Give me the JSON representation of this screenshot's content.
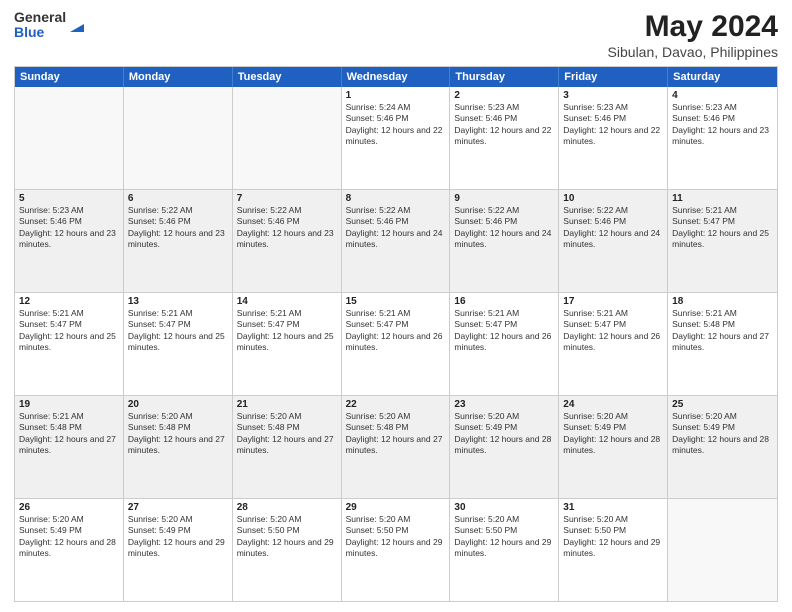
{
  "logo": {
    "line1": "General",
    "line2": "Blue"
  },
  "header": {
    "month_year": "May 2024",
    "location": "Sibulan, Davao, Philippines"
  },
  "days": [
    "Sunday",
    "Monday",
    "Tuesday",
    "Wednesday",
    "Thursday",
    "Friday",
    "Saturday"
  ],
  "weeks": [
    [
      {
        "day": "",
        "info": "",
        "empty": true
      },
      {
        "day": "",
        "info": "",
        "empty": true
      },
      {
        "day": "",
        "info": "",
        "empty": true
      },
      {
        "day": "1",
        "info": "Sunrise: 5:24 AM\nSunset: 5:46 PM\nDaylight: 12 hours and 22 minutes."
      },
      {
        "day": "2",
        "info": "Sunrise: 5:23 AM\nSunset: 5:46 PM\nDaylight: 12 hours and 22 minutes."
      },
      {
        "day": "3",
        "info": "Sunrise: 5:23 AM\nSunset: 5:46 PM\nDaylight: 12 hours and 22 minutes."
      },
      {
        "day": "4",
        "info": "Sunrise: 5:23 AM\nSunset: 5:46 PM\nDaylight: 12 hours and 23 minutes."
      }
    ],
    [
      {
        "day": "5",
        "info": "Sunrise: 5:23 AM\nSunset: 5:46 PM\nDaylight: 12 hours and 23 minutes."
      },
      {
        "day": "6",
        "info": "Sunrise: 5:22 AM\nSunset: 5:46 PM\nDaylight: 12 hours and 23 minutes."
      },
      {
        "day": "7",
        "info": "Sunrise: 5:22 AM\nSunset: 5:46 PM\nDaylight: 12 hours and 23 minutes."
      },
      {
        "day": "8",
        "info": "Sunrise: 5:22 AM\nSunset: 5:46 PM\nDaylight: 12 hours and 24 minutes."
      },
      {
        "day": "9",
        "info": "Sunrise: 5:22 AM\nSunset: 5:46 PM\nDaylight: 12 hours and 24 minutes."
      },
      {
        "day": "10",
        "info": "Sunrise: 5:22 AM\nSunset: 5:46 PM\nDaylight: 12 hours and 24 minutes."
      },
      {
        "day": "11",
        "info": "Sunrise: 5:21 AM\nSunset: 5:47 PM\nDaylight: 12 hours and 25 minutes."
      }
    ],
    [
      {
        "day": "12",
        "info": "Sunrise: 5:21 AM\nSunset: 5:47 PM\nDaylight: 12 hours and 25 minutes."
      },
      {
        "day": "13",
        "info": "Sunrise: 5:21 AM\nSunset: 5:47 PM\nDaylight: 12 hours and 25 minutes."
      },
      {
        "day": "14",
        "info": "Sunrise: 5:21 AM\nSunset: 5:47 PM\nDaylight: 12 hours and 25 minutes."
      },
      {
        "day": "15",
        "info": "Sunrise: 5:21 AM\nSunset: 5:47 PM\nDaylight: 12 hours and 26 minutes."
      },
      {
        "day": "16",
        "info": "Sunrise: 5:21 AM\nSunset: 5:47 PM\nDaylight: 12 hours and 26 minutes."
      },
      {
        "day": "17",
        "info": "Sunrise: 5:21 AM\nSunset: 5:47 PM\nDaylight: 12 hours and 26 minutes."
      },
      {
        "day": "18",
        "info": "Sunrise: 5:21 AM\nSunset: 5:48 PM\nDaylight: 12 hours and 27 minutes."
      }
    ],
    [
      {
        "day": "19",
        "info": "Sunrise: 5:21 AM\nSunset: 5:48 PM\nDaylight: 12 hours and 27 minutes."
      },
      {
        "day": "20",
        "info": "Sunrise: 5:20 AM\nSunset: 5:48 PM\nDaylight: 12 hours and 27 minutes."
      },
      {
        "day": "21",
        "info": "Sunrise: 5:20 AM\nSunset: 5:48 PM\nDaylight: 12 hours and 27 minutes."
      },
      {
        "day": "22",
        "info": "Sunrise: 5:20 AM\nSunset: 5:48 PM\nDaylight: 12 hours and 27 minutes."
      },
      {
        "day": "23",
        "info": "Sunrise: 5:20 AM\nSunset: 5:49 PM\nDaylight: 12 hours and 28 minutes."
      },
      {
        "day": "24",
        "info": "Sunrise: 5:20 AM\nSunset: 5:49 PM\nDaylight: 12 hours and 28 minutes."
      },
      {
        "day": "25",
        "info": "Sunrise: 5:20 AM\nSunset: 5:49 PM\nDaylight: 12 hours and 28 minutes."
      }
    ],
    [
      {
        "day": "26",
        "info": "Sunrise: 5:20 AM\nSunset: 5:49 PM\nDaylight: 12 hours and 28 minutes."
      },
      {
        "day": "27",
        "info": "Sunrise: 5:20 AM\nSunset: 5:49 PM\nDaylight: 12 hours and 29 minutes."
      },
      {
        "day": "28",
        "info": "Sunrise: 5:20 AM\nSunset: 5:50 PM\nDaylight: 12 hours and 29 minutes."
      },
      {
        "day": "29",
        "info": "Sunrise: 5:20 AM\nSunset: 5:50 PM\nDaylight: 12 hours and 29 minutes."
      },
      {
        "day": "30",
        "info": "Sunrise: 5:20 AM\nSunset: 5:50 PM\nDaylight: 12 hours and 29 minutes."
      },
      {
        "day": "31",
        "info": "Sunrise: 5:20 AM\nSunset: 5:50 PM\nDaylight: 12 hours and 29 minutes."
      },
      {
        "day": "",
        "info": "",
        "empty": true
      }
    ]
  ]
}
